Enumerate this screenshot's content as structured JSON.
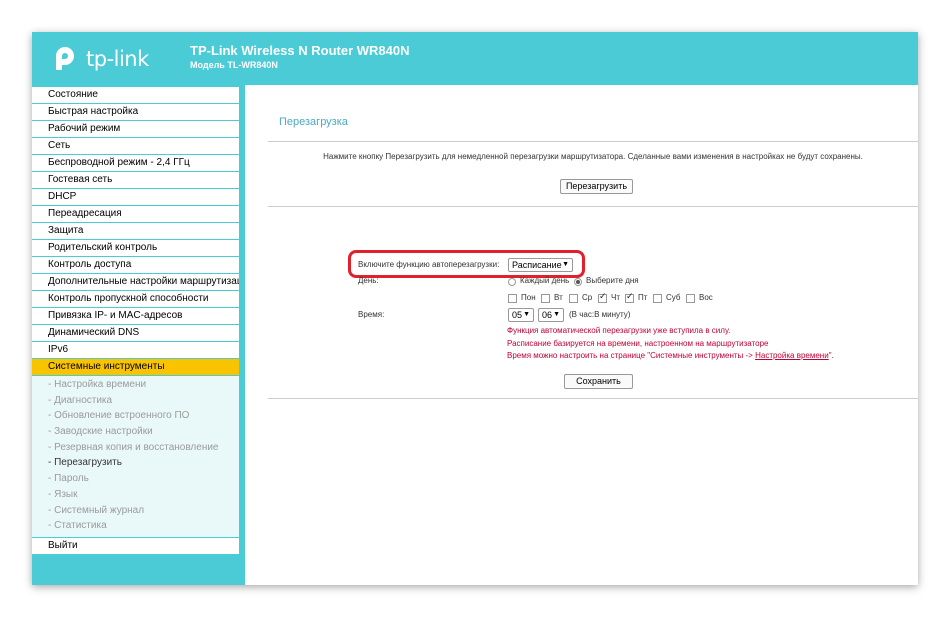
{
  "header": {
    "logo_text": "tp-link",
    "title": "TP-Link Wireless N Router WR840N",
    "model": "Модель TL-WR840N"
  },
  "sidebar": {
    "items": [
      {
        "label": "Состояние"
      },
      {
        "label": "Быстрая настройка"
      },
      {
        "label": "Рабочий режим"
      },
      {
        "label": "Сеть"
      },
      {
        "label": "Беспроводной режим - 2,4 ГГц"
      },
      {
        "label": "Гостевая сеть"
      },
      {
        "label": "DHCP"
      },
      {
        "label": "Переадресация"
      },
      {
        "label": "Защита"
      },
      {
        "label": "Родительский контроль"
      },
      {
        "label": "Контроль доступа"
      },
      {
        "label": "Дополнительные настройки маршрутизации"
      },
      {
        "label": "Контроль пропускной способности"
      },
      {
        "label": "Привязка IP- и MAC-адресов"
      },
      {
        "label": "Динамический DNS"
      },
      {
        "label": "IPv6"
      },
      {
        "label": "Системные инструменты"
      }
    ],
    "subitems": [
      {
        "label": "- Настройка времени"
      },
      {
        "label": "- Диагностика"
      },
      {
        "label": "- Обновление встроенного ПО"
      },
      {
        "label": "- Заводские настройки"
      },
      {
        "label": "- Резервная копия и восстановление"
      },
      {
        "label": "- Перезагрузить"
      },
      {
        "label": "- Пароль"
      },
      {
        "label": "- Язык"
      },
      {
        "label": "- Системный журнал"
      },
      {
        "label": "- Статистика"
      }
    ],
    "logout": "Выйти"
  },
  "main": {
    "title": "Перезагрузка",
    "description": "Нажмите кнопку Перезагрузить для немедленной перезагрузки маршрутизатора. Сделанные вами изменения в настройках не будут сохранены.",
    "reboot_button": "Перезагрузить",
    "auto_reboot_label": "Включите функцию автоперезагрузки:",
    "auto_reboot_value": "Расписание",
    "day_label": "День:",
    "radio_every_day": "Каждый день",
    "radio_select_days": "Выберите дня",
    "days": [
      {
        "label": "Пон",
        "checked": false
      },
      {
        "label": "Вт",
        "checked": false
      },
      {
        "label": "Ср",
        "checked": false
      },
      {
        "label": "Чт",
        "checked": true
      },
      {
        "label": "Пт",
        "checked": true
      },
      {
        "label": "Суб",
        "checked": false
      },
      {
        "label": "Вос",
        "checked": false
      }
    ],
    "time_label": "Время:",
    "hour_value": "05",
    "minute_value": "06",
    "time_hint": "(В час:В минуту)",
    "notice_1": "Функция автоматической перезагрузки уже вступила в силу.",
    "notice_2": "Расписание базируется на времени, настроенном на маршрутизаторе",
    "notice_3_prefix": "Время можно настроить на странице \"Системные инструменты ->",
    "notice_3_link": "Настройка времени",
    "notice_3_suffix": "\".",
    "save_button": "Сохранить"
  },
  "colors": {
    "header": "#4acbd6",
    "active_menu": "#f9c300",
    "title": "#4aa9c4",
    "notice": "#c00033",
    "highlight": "#e0202a"
  }
}
